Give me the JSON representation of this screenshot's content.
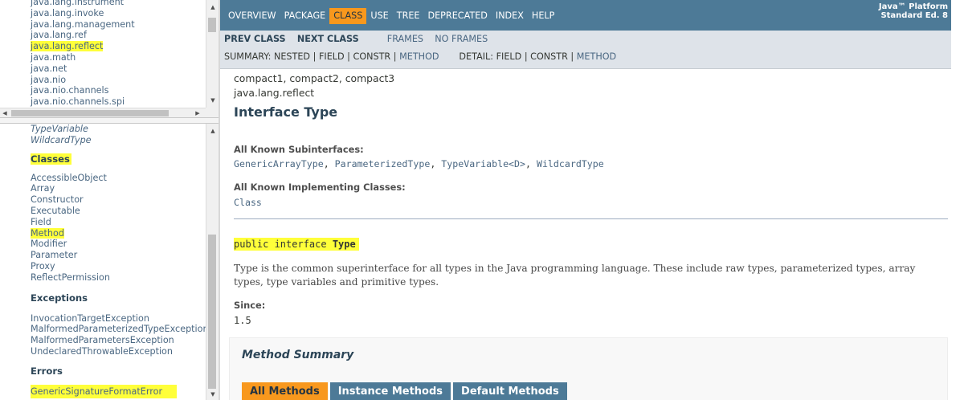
{
  "left_packages": {
    "items": [
      "java.lang.instrument",
      "java.lang.invoke",
      "java.lang.management",
      "java.lang.ref",
      "java.lang.reflect",
      "java.math",
      "java.net",
      "java.nio",
      "java.nio.channels",
      "java.nio.channels.spi"
    ],
    "highlighted": "java.lang.reflect"
  },
  "left_classes": {
    "interfaces_tail": [
      "TypeVariable",
      "WildcardType"
    ],
    "classes_heading": "Classes",
    "classes": [
      "AccessibleObject",
      "Array",
      "Constructor",
      "Executable",
      "Field",
      "Method",
      "Modifier",
      "Parameter",
      "Proxy",
      "ReflectPermission"
    ],
    "highlighted_class": "Method",
    "exceptions_heading": "Exceptions",
    "exceptions": [
      "InvocationTargetException",
      "MalformedParameterizedTypeException",
      "MalformedParametersException",
      "UndeclaredThrowableException"
    ],
    "errors_heading": "Errors",
    "errors": [
      "GenericSignatureFormatError"
    ]
  },
  "topnav": {
    "items": [
      "OVERVIEW",
      "PACKAGE",
      "CLASS",
      "USE",
      "TREE",
      "DEPRECATED",
      "INDEX",
      "HELP"
    ],
    "active": "CLASS",
    "about_line1": "Java™ Platform",
    "about_line2": "Standard Ed. 8"
  },
  "subnav": {
    "prev_class": "PREV CLASS",
    "next_class": "NEXT CLASS",
    "frames": "FRAMES",
    "no_frames": "NO FRAMES",
    "summary_label": "SUMMARY:",
    "summary_nested": "NESTED",
    "summary_field": "FIELD",
    "summary_constr": "CONSTR",
    "summary_method": "METHOD",
    "detail_label": "DETAIL:",
    "detail_field": "FIELD",
    "detail_constr": "CONSTR",
    "detail_method": "METHOD"
  },
  "main": {
    "profiles": "compact1, compact2, compact3",
    "package": "java.lang.reflect",
    "title": "Interface Type",
    "subinterfaces_label": "All Known Subinterfaces:",
    "subinterfaces": [
      "GenericArrayType",
      "ParameterizedType",
      "TypeVariable<D>",
      "WildcardType"
    ],
    "implementing_label": "All Known Implementing Classes:",
    "implementing": "Class",
    "signature_prefix": "public interface ",
    "signature_name": "Type",
    "description": "Type is the common superinterface for all types in the Java programming language. These include raw types, parameterized types, array types, type variables and primitive types.",
    "since_label": "Since:",
    "since_value": "1.5",
    "method_summary_title": "Method Summary",
    "method_tabs": [
      "All Methods",
      "Instance Methods",
      "Default Methods"
    ],
    "active_tab": "All Methods"
  },
  "colors": {
    "nav_bg": "#4d7a97",
    "subnav_bg": "#dee3e9",
    "active_orange": "#f8981d",
    "highlight_yellow": "#ffff3a",
    "link": "#4a6782"
  }
}
